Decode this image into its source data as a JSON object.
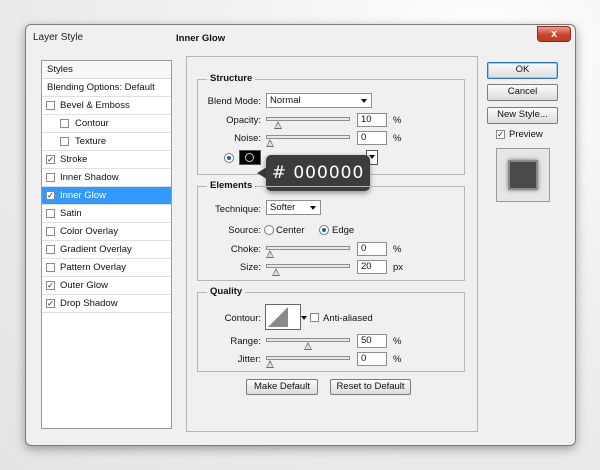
{
  "window": {
    "title": "Layer Style",
    "close": "x"
  },
  "styles": {
    "header": "Styles",
    "blending": "Blending Options: Default",
    "items": [
      {
        "label": "Bevel & Emboss",
        "checked": false
      },
      {
        "label": "Contour",
        "checked": false,
        "sub": true
      },
      {
        "label": "Texture",
        "checked": false,
        "sub": true
      },
      {
        "label": "Stroke",
        "checked": true
      },
      {
        "label": "Inner Shadow",
        "checked": false
      },
      {
        "label": "Inner Glow",
        "checked": true,
        "selected": true
      },
      {
        "label": "Satin",
        "checked": false
      },
      {
        "label": "Color Overlay",
        "checked": false
      },
      {
        "label": "Gradient Overlay",
        "checked": false
      },
      {
        "label": "Pattern Overlay",
        "checked": false
      },
      {
        "label": "Outer Glow",
        "checked": true
      },
      {
        "label": "Drop Shadow",
        "checked": true
      }
    ]
  },
  "panel": {
    "title": "Inner Glow",
    "structure": {
      "title": "Structure",
      "blend_mode_label": "Blend Mode:",
      "blend_mode": "Normal",
      "opacity_label": "Opacity:",
      "opacity": "10",
      "noise_label": "Noise:",
      "noise": "0",
      "percent": "%",
      "color_hex": "# 000000",
      "color": "#000000",
      "opacity_level": 0.1,
      "noise_level": 0.0
    },
    "elements": {
      "title": "Elements",
      "technique_label": "Technique:",
      "technique": "Softer",
      "source_label": "Source:",
      "source_center": "Center",
      "source_edge": "Edge",
      "choke_label": "Choke:",
      "choke": "0",
      "size_label": "Size:",
      "size": "20",
      "percent": "%",
      "px": "px",
      "choke_level": 0.0,
      "size_level": 0.08
    },
    "quality": {
      "title": "Quality",
      "contour_label": "Contour:",
      "anti_aliased": "Anti-aliased",
      "range_label": "Range:",
      "range": "50",
      "jitter_label": "Jitter:",
      "jitter": "0",
      "percent": "%",
      "range_level": 0.5,
      "jitter_level": 0.0
    },
    "make_default": "Make Default",
    "reset_default": "Reset to Default"
  },
  "buttons": {
    "ok": "OK",
    "cancel": "Cancel",
    "new_style": "New Style...",
    "preview": "Preview"
  },
  "colors": {
    "selection": "#3399ff",
    "tooltip": "#3c3c3c",
    "close": "#c8452f"
  }
}
